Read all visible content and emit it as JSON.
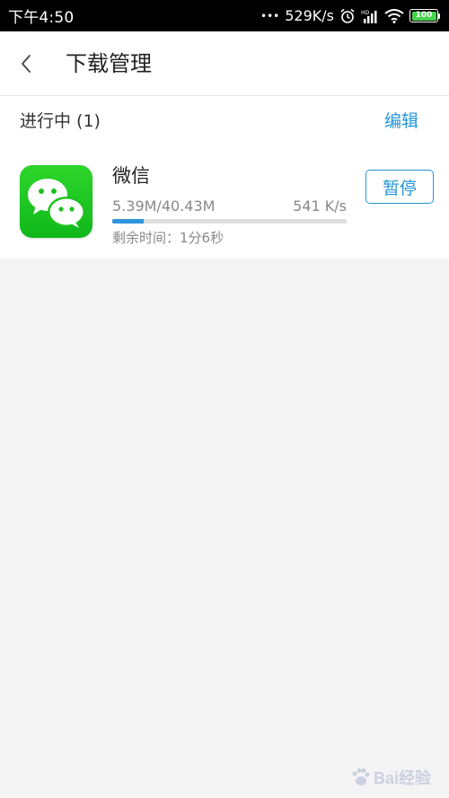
{
  "status_bar": {
    "time": "下午4:50",
    "dots": "•••",
    "net_speed": "529K/s",
    "battery": "100"
  },
  "header": {
    "title": "下载管理",
    "back_icon": "chevron-left-icon"
  },
  "section": {
    "title": "进行中 (1)",
    "edit_label": "编辑"
  },
  "download": {
    "app_name": "微信",
    "size": "5.39M/40.43M",
    "speed": "541 K/s",
    "progress": 0.133,
    "remaining": "剩余时间：1分6秒",
    "pause_label": "暂停",
    "icon": "wechat-icon"
  },
  "watermark": {
    "text": "Bai经验"
  },
  "colors": {
    "accent": "#2196d9",
    "wechat_green": "#1ec71e",
    "background": "#f4f4f4"
  }
}
